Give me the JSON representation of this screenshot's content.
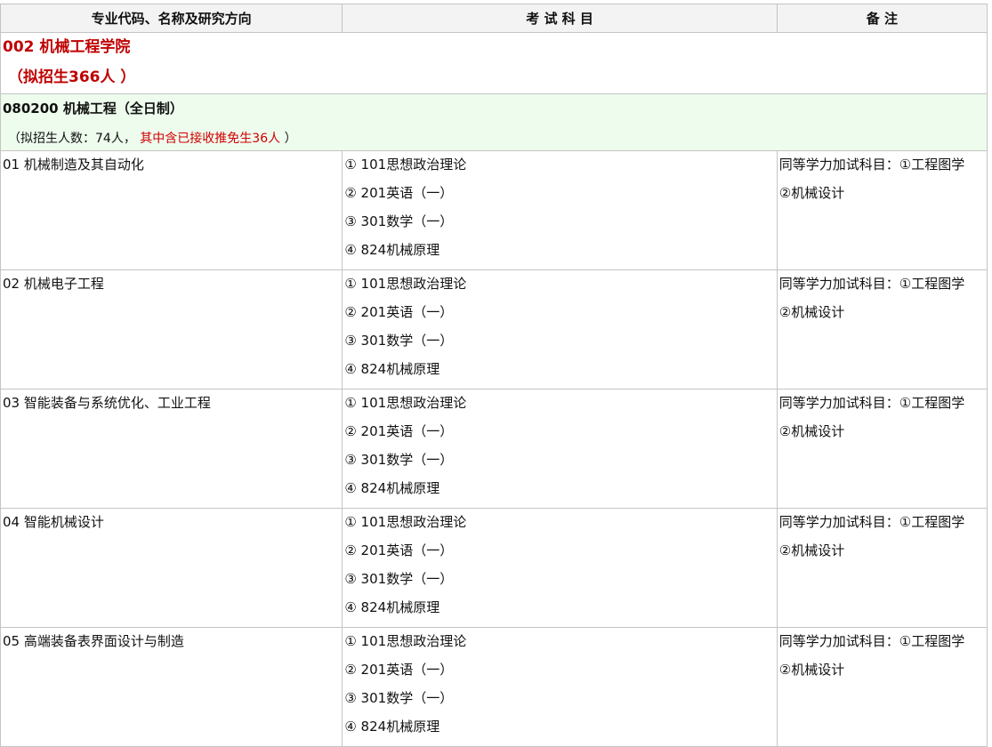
{
  "header": {
    "col1": "专业代码、名称及研究方向",
    "col2": "考 试 科 目",
    "col3": "备 注"
  },
  "college": {
    "name": "002 机械工程学院",
    "quota": "（拟招生366人 ）"
  },
  "major": {
    "title": "080200 机械工程（全日制）",
    "quota_prefix": "（拟招生人数：74人，",
    "quota_red": "其中含已接收推免生36人",
    "quota_suffix": "）"
  },
  "directions": [
    {
      "name": "01 机械制造及其自动化",
      "subjects": [
        "① 101思想政治理论",
        "② 201英语（一）",
        "③ 301数学（一）",
        "④ 824机械原理"
      ],
      "note1": "同等学力加试科目：①工程图学",
      "note2": "②机械设计"
    },
    {
      "name": "02 机械电子工程",
      "subjects": [
        "① 101思想政治理论",
        "② 201英语（一）",
        "③ 301数学（一）",
        "④ 824机械原理"
      ],
      "note1": "同等学力加试科目：①工程图学",
      "note2": "②机械设计"
    },
    {
      "name": "03 智能装备与系统优化、工业工程",
      "subjects": [
        "① 101思想政治理论",
        "② 201英语（一）",
        "③ 301数学（一）",
        "④ 824机械原理"
      ],
      "note1": "同等学力加试科目：①工程图学",
      "note2": "②机械设计"
    },
    {
      "name": "04 智能机械设计",
      "subjects": [
        "① 101思想政治理论",
        "② 201英语（一）",
        "③ 301数学（一）",
        "④ 824机械原理"
      ],
      "note1": "同等学力加试科目：①工程图学",
      "note2": "②机械设计"
    },
    {
      "name": "05 高端装备表界面设计与制造",
      "subjects": [
        "① 101思想政治理论",
        "② 201英语（一）",
        "③ 301数学（一）",
        "④ 824机械原理"
      ],
      "note1": "同等学力加试科目：①工程图学",
      "note2": "②机械设计"
    }
  ]
}
